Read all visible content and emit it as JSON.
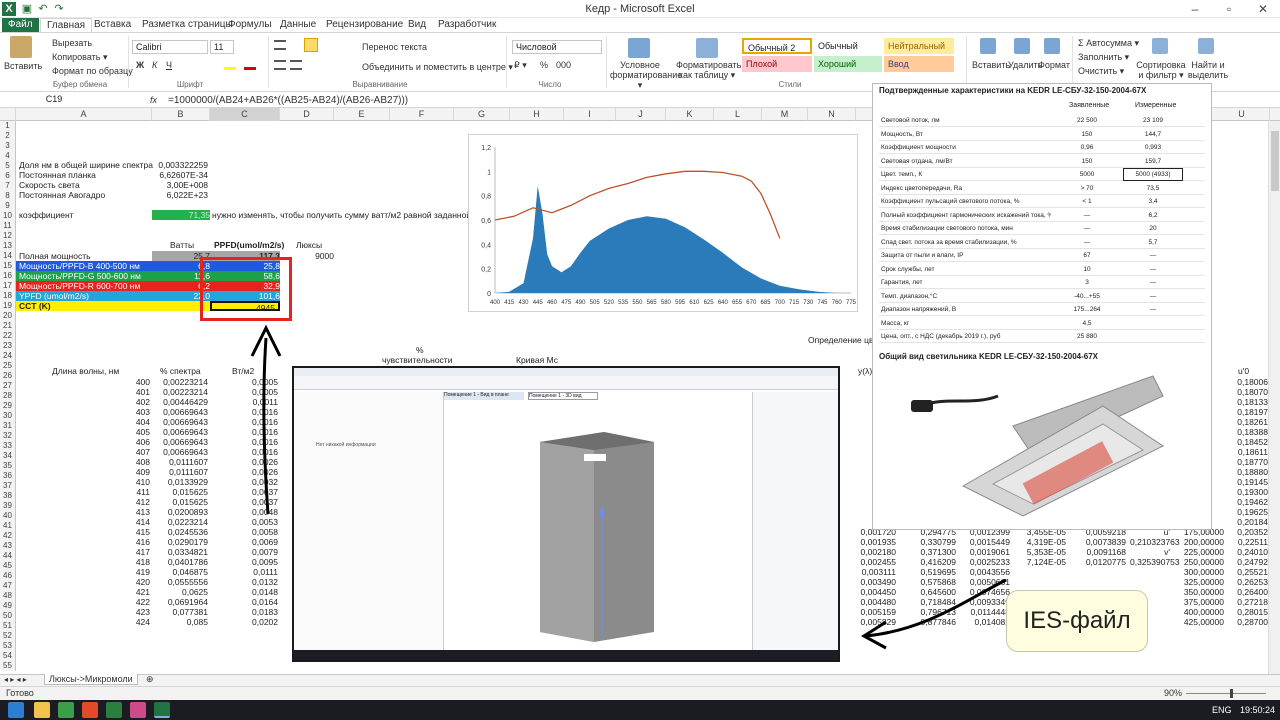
{
  "window": {
    "title": "Кедр - Microsoft Excel"
  },
  "tabs": [
    "Файл",
    "Главная",
    "Вставка",
    "Разметка страницы",
    "Формулы",
    "Данные",
    "Рецензирование",
    "Вид",
    "Разработчик"
  ],
  "ribbon": {
    "paste": "Вставить",
    "cut": "Вырезать",
    "copy": "Копировать ▾",
    "format_painter": "Формат по образцу",
    "font_name": "Calibri",
    "font_size": "11",
    "bold": "Ж",
    "italic": "К",
    "underline": "Ч",
    "wrap": "Перенос текста",
    "merge": "Объединить и поместить в центре ▾",
    "num_format": "Числовой",
    "percent": "%",
    "thousands": "000",
    "cond_format": "Условное форматирование ▾",
    "as_table": "Форматировать как таблицу ▾",
    "styles": [
      "Обычный 2",
      "Обычный",
      "Нейтральный",
      "Плохой",
      "Хороший",
      "Ввод"
    ],
    "insert": "Вставить",
    "delete": "Удалить",
    "format": "Формат",
    "autosum": "Σ Автосумма ▾",
    "fill": "Заполнить ▾",
    "clear": "Очистить ▾",
    "sort": "Сортировка и фильтр ▾",
    "find": "Найти и выделить ▾",
    "groups": [
      "Буфер обмена",
      "Шрифт",
      "Выравнивание",
      "Число",
      "Стили",
      "Ячейки",
      "Редактирование"
    ]
  },
  "formula_bar": {
    "name_box": "C19",
    "fx": "fx",
    "formula": "=1000000/(AB24+AB26*((AB25-AB24)/(AB26-AB27)))"
  },
  "columns": [
    "A",
    "B",
    "C",
    "D",
    "E",
    "F",
    "G",
    "H",
    "I",
    "J",
    "K",
    "L",
    "M",
    "N",
    "T",
    "U"
  ],
  "rows": {
    "r5": [
      "Доля нм в общей ширине спектра",
      "0,003322259"
    ],
    "r6": [
      "Постоянная планка",
      "6,62607E-34"
    ],
    "r7": [
      "Скорость света",
      "3,00E+008"
    ],
    "r8": [
      "Постоянная Авогадро",
      "6,022E+23"
    ],
    "r10": [
      "коэффициент",
      "71,35",
      "нужно изменять, чтобы получить сумму ватт/м2 равной заданной"
    ],
    "r13": [
      "Ватты",
      "PPFD(umol/m2/s)",
      "Люксы"
    ],
    "r14": [
      "Полная мощность",
      "25,7",
      "117,3",
      "9000"
    ],
    "r15": [
      "Мощность/PPFD-B 400-500 нм",
      "6,8",
      "25,8"
    ],
    "r16": [
      "Мощность/PPFD-G 500-600 нм",
      "11,6",
      "58,6"
    ],
    "r17": [
      "Мощность/PPFD-R 600-700 нм",
      "6,2",
      "32,9"
    ],
    "r18": [
      "YPFD (umol/m2/s)",
      "22,0",
      "101,6"
    ],
    "r19": [
      "CCT (K)",
      "",
      "4945"
    ],
    "r21": [
      "%"
    ],
    "r22": [
      "чувствительности",
      "Кривая  Мс",
      "Определение цв"
    ],
    "r23": [
      "Длина волны, нм",
      "% спектра",
      "Вт/м2",
      "y(λ)",
      "u'0"
    ]
  },
  "table": {
    "wavelengths": [
      "400",
      "401",
      "402",
      "403",
      "404",
      "405",
      "406",
      "407",
      "408",
      "409",
      "410",
      "411",
      "412",
      "413",
      "414",
      "415",
      "416",
      "417",
      "418",
      "419",
      "420",
      "421",
      "422",
      "423",
      "424"
    ],
    "spectrum": [
      "0,00223214",
      "0,00223214",
      "0,00446429",
      "0,00669643",
      "0,00669643",
      "0,00669643",
      "0,00669643",
      "0,00669643",
      "0,0111607",
      "0,0111607",
      "0,0133929",
      "0,015625",
      "0,015625",
      "0,0200893",
      "0,0223214",
      "0,0245536",
      "0,0290179",
      "0,0334821",
      "0,0401786",
      "0,046875",
      "0,0555556",
      "0,0625",
      "0,0691964",
      "0,077381",
      "0,085"
    ],
    "watts": [
      "0,0005",
      "0,0005",
      "0,0011",
      "0,0016",
      "0,0016",
      "0,0016",
      "0,0016",
      "0,0016",
      "0,0026",
      "0,0026",
      "0,0032",
      "0,0037",
      "0,0037",
      "0,0048",
      "0,0053",
      "0,0058",
      "0,0069",
      "0,0079",
      "0,0095",
      "0,0111",
      "0,0132",
      "0,0148",
      "0,0164",
      "0,0183",
      "0,0202"
    ],
    "right_col": [
      "0,18006",
      "0,18070",
      "0,18133",
      "0,18197",
      "0,18261",
      "0,18388",
      "0,18452",
      "0,18611",
      "0,18770",
      "0,18880",
      "0,19145",
      "0,19300",
      "0,19462",
      "0,19625",
      "0,20184",
      "0,20352",
      "0,22511",
      "0,24010",
      "0,24792",
      "0,25521",
      "0,26253",
      "0,26400",
      "0,27218",
      "0,28015",
      "0,28700"
    ],
    "mid_rows": [
      [
        "0,001720",
        "0,294775",
        "0,0012399",
        "3,455E-05",
        "0,0059218",
        "u'",
        "175,00000"
      ],
      [
        "0,001935",
        "0,330799",
        "0,0015449",
        "4,319E-05",
        "0,0073839",
        "0,210323763",
        "200,00000"
      ],
      [
        "0,002180",
        "0,371300",
        "0,0019061",
        "5,353E-05",
        "0,0091168",
        "v'",
        "225,00000"
      ],
      [
        "0,002455",
        "0,416209",
        "0,0025233",
        "7,124E-05",
        "0,0120775",
        "0,325390753",
        "250,00000"
      ],
      [
        "0,003111",
        "0,519695",
        "0,0043556",
        "",
        "",
        "",
        "300,00000"
      ],
      [
        "0,003490",
        "0,575868",
        "0,0050661",
        "",
        "",
        "",
        "325,00000"
      ],
      [
        "0,004450",
        "0,645600",
        "0,0074656",
        "",
        "",
        "",
        "350,00000"
      ],
      [
        "0,004480",
        "0,718484",
        "0,0093349",
        "",
        "",
        "",
        "375,00000"
      ],
      [
        "0,005159",
        "0,796713",
        "0,0114448",
        "",
        "",
        "",
        "400,00000"
      ],
      [
        "0,005829",
        "0,877846",
        "0,014082",
        "0,0004511",
        "0,0679286",
        "",
        "425,00000"
      ]
    ]
  },
  "chart": {
    "yticks": [
      "0",
      "0,2",
      "0,4",
      "0,6",
      "0,8",
      "1",
      "1,2"
    ],
    "xticks": [
      "400",
      "415",
      "430",
      "445",
      "460",
      "475",
      "490",
      "505",
      "520",
      "535",
      "550",
      "565",
      "580",
      "595",
      "610",
      "625",
      "640",
      "655",
      "670",
      "685",
      "700",
      "715",
      "730",
      "745",
      "760",
      "775"
    ]
  },
  "chart_data": {
    "type": "area",
    "ylim": [
      0,
      1.2
    ],
    "xlim": [
      400,
      775
    ],
    "series": [
      {
        "type": "area",
        "x": [
          400,
          415,
          430,
          440,
          445,
          450,
          455,
          460,
          470,
          480,
          490,
          500,
          520,
          540,
          560,
          580,
          600,
          620,
          640,
          660,
          680,
          700,
          720,
          740,
          760,
          775
        ],
        "values": [
          0.0,
          0.01,
          0.08,
          0.45,
          0.88,
          0.65,
          0.32,
          0.22,
          0.17,
          0.22,
          0.33,
          0.43,
          0.53,
          0.6,
          0.63,
          0.61,
          0.54,
          0.44,
          0.33,
          0.21,
          0.12,
          0.06,
          0.03,
          0.01,
          0.0,
          0.0
        ]
      },
      {
        "type": "line",
        "x": [
          400,
          420,
          440,
          460,
          480,
          500,
          520,
          540,
          560,
          580,
          600,
          620,
          640,
          660,
          670,
          680,
          690,
          700
        ],
        "values": [
          0.6,
          0.63,
          0.7,
          0.66,
          0.72,
          0.8,
          0.86,
          0.9,
          0.95,
          0.98,
          1.0,
          1.0,
          0.99,
          0.96,
          0.92,
          0.82,
          0.65,
          0.45
        ]
      }
    ]
  },
  "spec_panel": {
    "title": "Подтвержденные характеристики на KEDR LE-СБУ-32-150-2004-67Х",
    "header": [
      "",
      "Заявленные",
      "Измеренные"
    ],
    "rows": [
      [
        "Световой поток, лм",
        "22 500",
        "23 109"
      ],
      [
        "Мощность, Вт",
        "150",
        "144,7"
      ],
      [
        "Коэффициент мощности",
        "0,96",
        "0,993"
      ],
      [
        "Световая отдача, лм/Вт",
        "150",
        "159,7"
      ],
      [
        "Цвет. темп., К",
        "5000",
        "5000 (4933)"
      ],
      [
        "Индекс цветопередачи, Ra",
        "> 70",
        "73,5"
      ],
      [
        "Коэффициент пульсаций светового потока, %",
        "< 1",
        "3,4"
      ],
      [
        "Полный коэффициент гармонических искажений тока, %",
        "—",
        "6,2"
      ],
      [
        "Время стабилизации светового потока, мин",
        "—",
        "20"
      ],
      [
        "Спад свет. потока за время стабилизации, %",
        "—",
        "5,7"
      ],
      [
        "Защита от пыли и влаги, IP",
        "67",
        "—"
      ],
      [
        "Срок службы, лет",
        "10",
        "—"
      ],
      [
        "Гарантия, лет",
        "3",
        "—"
      ],
      [
        "Темп. диапазон,°С",
        "-40...+55",
        "—"
      ],
      [
        "Диапазон напряжений, В",
        "175...264",
        "—"
      ],
      [
        "Масса, кг",
        "4,5",
        ""
      ],
      [
        "Цена, опт., с НДС (декабрь 2019 г.), руб",
        "25 880",
        ""
      ]
    ],
    "photo_title": "Общий вид светильника KEDR LE-СБУ-32-150-2004-67Х"
  },
  "ies_label": "IES-файл",
  "embedded": {
    "left_text": "Нет никакой информации",
    "tab1": "Помещение 1 - Вид в плане",
    "tab2": "Помещение 1 - 3D вид"
  },
  "sheet_tab": "Люксы->Микромоли",
  "status": {
    "ready": "Готово",
    "zoom": "90%"
  },
  "taskbar": {
    "lang": "ENG",
    "time": "19:50:24"
  }
}
